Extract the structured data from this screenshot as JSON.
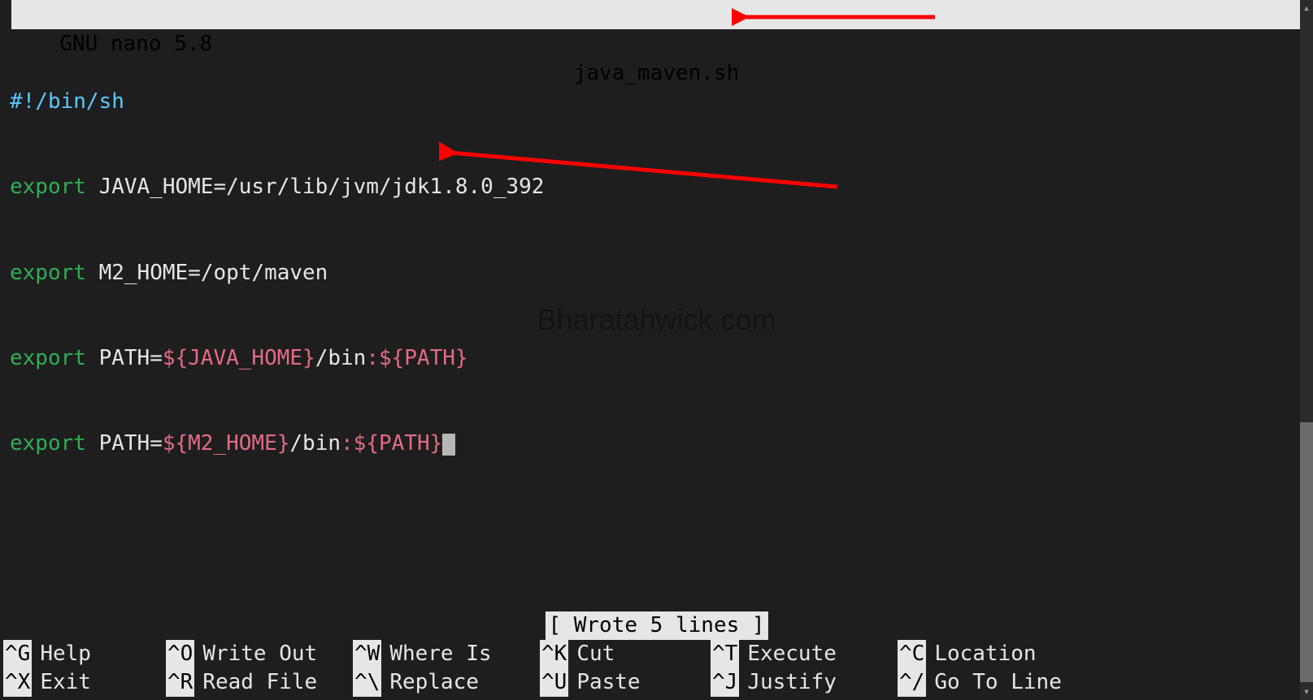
{
  "titlebar": {
    "app": "GNU nano 5.8",
    "filename": "java_maven.sh"
  },
  "code": {
    "line1": "#!/bin/sh",
    "l2_kw": "export",
    "l2_rest": " JAVA_HOME=/usr/lib/jvm/jdk1.8.0_392",
    "l3_kw": "export",
    "l3_rest": " M2_HOME=/opt/maven",
    "l4_kw": "export",
    "l4_a": " PATH=",
    "l4_b": "${JAVA_HOME}",
    "l4_c": "/bin",
    "l4_d": ":",
    "l4_e": "${PATH}",
    "l5_kw": "export",
    "l5_a": " PATH=",
    "l5_b": "${M2_HOME}",
    "l5_c": "/bin",
    "l5_d": ":",
    "l5_e": "${PATH}"
  },
  "watermark": "Bharatahwick.com",
  "status": "[ Wrote 5 lines ]",
  "shortcuts": {
    "row1": [
      {
        "key": "^G",
        "label": "Help"
      },
      {
        "key": "^O",
        "label": "Write Out"
      },
      {
        "key": "^W",
        "label": "Where Is"
      },
      {
        "key": "^K",
        "label": "Cut"
      },
      {
        "key": "^T",
        "label": "Execute"
      },
      {
        "key": "^C",
        "label": "Location"
      }
    ],
    "row2": [
      {
        "key": "^X",
        "label": "Exit"
      },
      {
        "key": "^R",
        "label": "Read File"
      },
      {
        "key": "^\\",
        "label": "Replace"
      },
      {
        "key": "^U",
        "label": "Paste"
      },
      {
        "key": "^J",
        "label": "Justify"
      },
      {
        "key": "^/",
        "label": "Go To Line"
      }
    ]
  },
  "annotations": {
    "arrow1": "right-to-left-arrow",
    "arrow2": "right-to-left-arrow"
  }
}
